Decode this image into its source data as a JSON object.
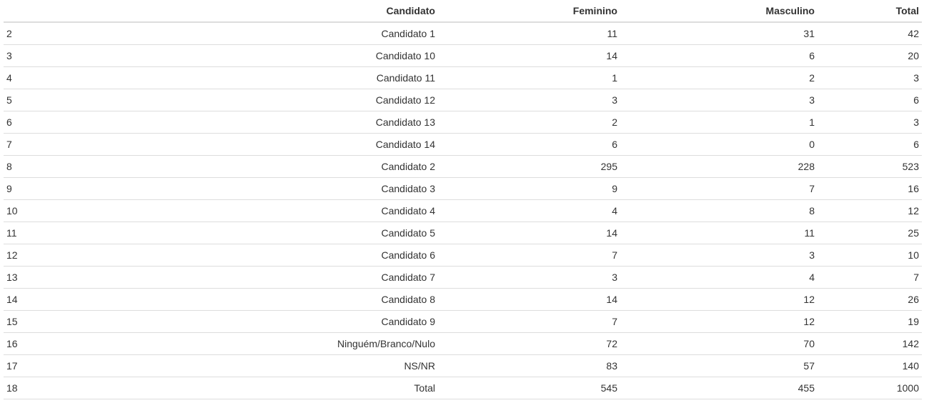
{
  "table": {
    "headers": [
      "",
      "Candidato",
      "Feminino",
      "Masculino",
      "Total"
    ],
    "rows": [
      [
        "2",
        "Candidato 1",
        "11",
        "31",
        "42"
      ],
      [
        "3",
        "Candidato 10",
        "14",
        "6",
        "20"
      ],
      [
        "4",
        "Candidato 11",
        "1",
        "2",
        "3"
      ],
      [
        "5",
        "Candidato 12",
        "3",
        "3",
        "6"
      ],
      [
        "6",
        "Candidato 13",
        "2",
        "1",
        "3"
      ],
      [
        "7",
        "Candidato 14",
        "6",
        "0",
        "6"
      ],
      [
        "8",
        "Candidato 2",
        "295",
        "228",
        "523"
      ],
      [
        "9",
        "Candidato 3",
        "9",
        "7",
        "16"
      ],
      [
        "10",
        "Candidato 4",
        "4",
        "8",
        "12"
      ],
      [
        "11",
        "Candidato 5",
        "14",
        "11",
        "25"
      ],
      [
        "12",
        "Candidato 6",
        "7",
        "3",
        "10"
      ],
      [
        "13",
        "Candidato 7",
        "3",
        "4",
        "7"
      ],
      [
        "14",
        "Candidato 8",
        "14",
        "12",
        "26"
      ],
      [
        "15",
        "Candidato 9",
        "7",
        "12",
        "19"
      ],
      [
        "16",
        "Ninguém/Branco/Nulo",
        "72",
        "70",
        "142"
      ],
      [
        "17",
        "NS/NR",
        "83",
        "57",
        "140"
      ],
      [
        "18",
        "Total",
        "545",
        "455",
        "1000"
      ]
    ]
  }
}
